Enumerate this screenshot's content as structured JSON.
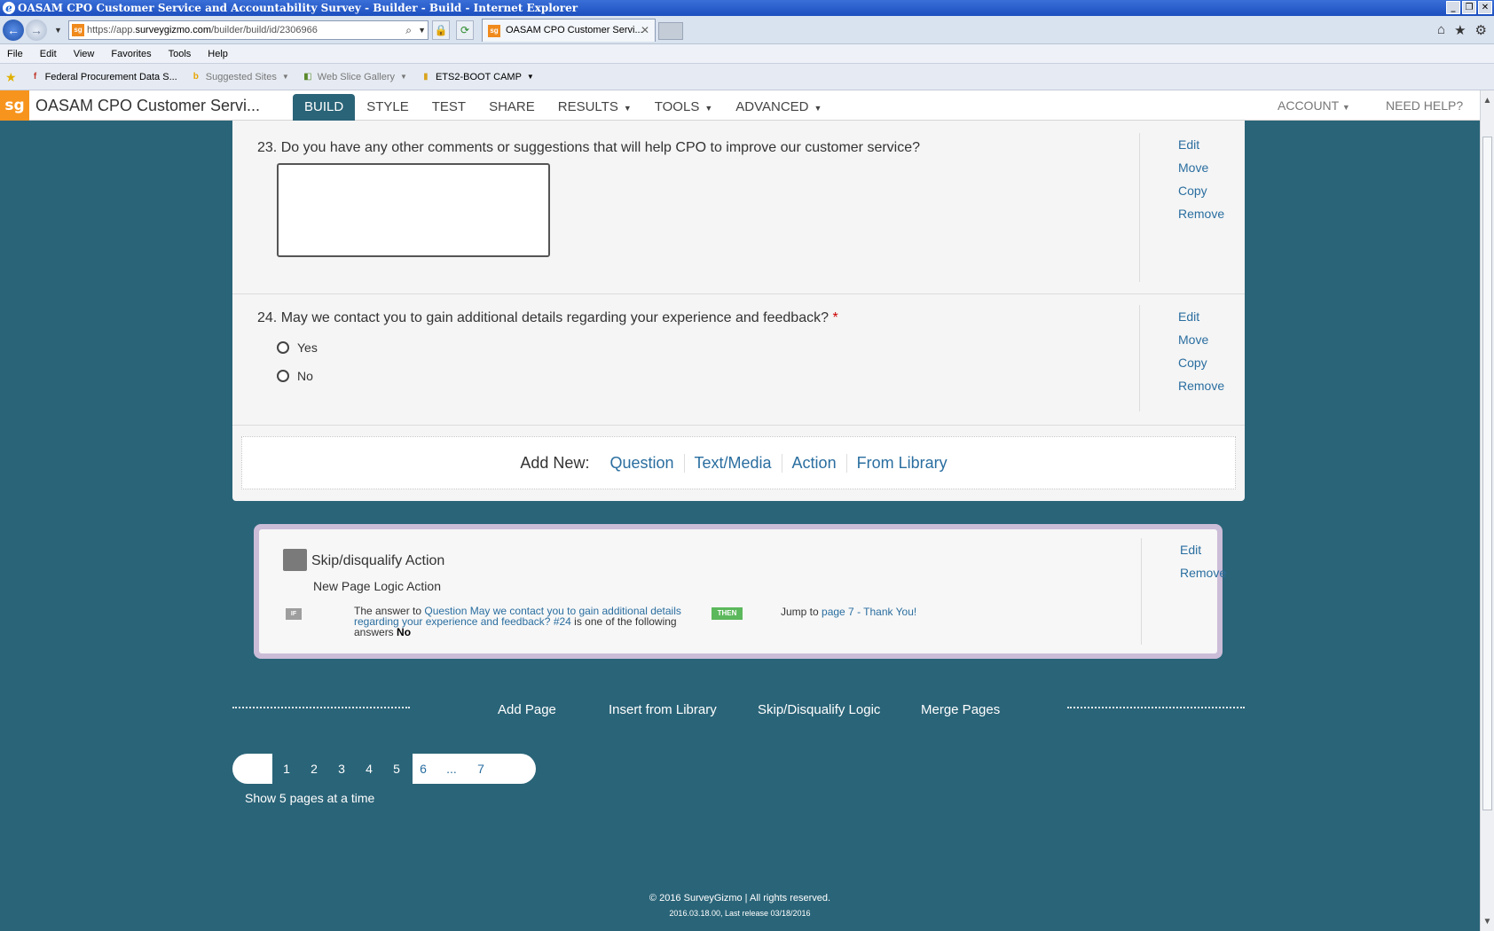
{
  "window": {
    "title": "OASAM CPO Customer Service and Accountability Survey - Builder - Build - Internet Explorer",
    "controls": [
      "_",
      "❐",
      "✕"
    ]
  },
  "browser": {
    "url_prefix": "https://app.",
    "url_host": "surveygizmo.com",
    "url_path": "/builder/build/id/2306966",
    "tab_title": "OASAM CPO Customer Servi...",
    "favicon_text": "sg",
    "menu": [
      "File",
      "Edit",
      "View",
      "Favorites",
      "Tools",
      "Help"
    ],
    "favorites": [
      {
        "label": "Federal Procurement Data S...",
        "icon": "fpds-icon",
        "dim": false
      },
      {
        "label": "Suggested Sites",
        "icon": "bing-icon",
        "dim": true
      },
      {
        "label": "Web Slice Gallery",
        "icon": "webslice-icon",
        "dim": true
      },
      {
        "label": "ETS2-BOOT CAMP",
        "icon": "folder-icon",
        "dim": false
      }
    ]
  },
  "app": {
    "logo": "sg",
    "survey_title": "OASAM CPO Customer Servi...",
    "nav": [
      {
        "label": "BUILD",
        "active": true,
        "caret": false
      },
      {
        "label": "STYLE",
        "active": false,
        "caret": false
      },
      {
        "label": "TEST",
        "active": false,
        "caret": false
      },
      {
        "label": "SHARE",
        "active": false,
        "caret": false
      },
      {
        "label": "RESULTS",
        "active": false,
        "caret": true
      },
      {
        "label": "TOOLS",
        "active": false,
        "caret": true
      },
      {
        "label": "ADVANCED",
        "active": false,
        "caret": true
      }
    ],
    "account": "ACCOUNT",
    "help": "NEED HELP?"
  },
  "questions": [
    {
      "number": "23.",
      "text": "Do you have any other comments or suggestions that will help CPO to improve our customer service?",
      "required": false,
      "type": "essay",
      "actions": [
        "Edit",
        "Move",
        "Copy",
        "Remove"
      ]
    },
    {
      "number": "24.",
      "text": "May we contact you to gain additional details regarding your experience and feedback?",
      "required": true,
      "required_mark": "*",
      "type": "radio",
      "options": [
        "Yes",
        "No"
      ],
      "actions": [
        "Edit",
        "Move",
        "Copy",
        "Remove"
      ]
    }
  ],
  "add_new": {
    "label": "Add New:",
    "links": [
      "Question",
      "Text/Media",
      "Action",
      "From Library"
    ]
  },
  "logic_action": {
    "title": "Skip/disqualify Action",
    "subtitle": "New Page Logic Action",
    "if_tag": "IF",
    "then_tag": "THEN",
    "condition_prefix": "The answer to ",
    "condition_link": "Question May we contact you to gain additional details regarding your experience and feedback? #24",
    "condition_mid": " is one of the following answers ",
    "condition_answer": "No",
    "jump_prefix": "Jump to ",
    "jump_link": "page 7 - Thank You!",
    "actions": [
      "Edit",
      "Remove"
    ]
  },
  "page_actions": [
    "Add Page",
    "Insert from Library",
    "Skip/Disqualify Logic",
    "Merge Pages"
  ],
  "pager": {
    "pages": [
      "1",
      "2",
      "3",
      "4",
      "5",
      "6",
      "...",
      "7"
    ],
    "show_label": "Show 5 pages at a time"
  },
  "footer": {
    "copyright": "© 2016 SurveyGizmo | All rights reserved.",
    "release": "2016.03.18.00, Last release 03/18/2016"
  },
  "colors": {
    "background": "#2a6478",
    "link": "#2a6ea0",
    "brand_orange": "#f7941d",
    "action_border": "#cbbcd8",
    "then_green": "#5cb85c"
  }
}
